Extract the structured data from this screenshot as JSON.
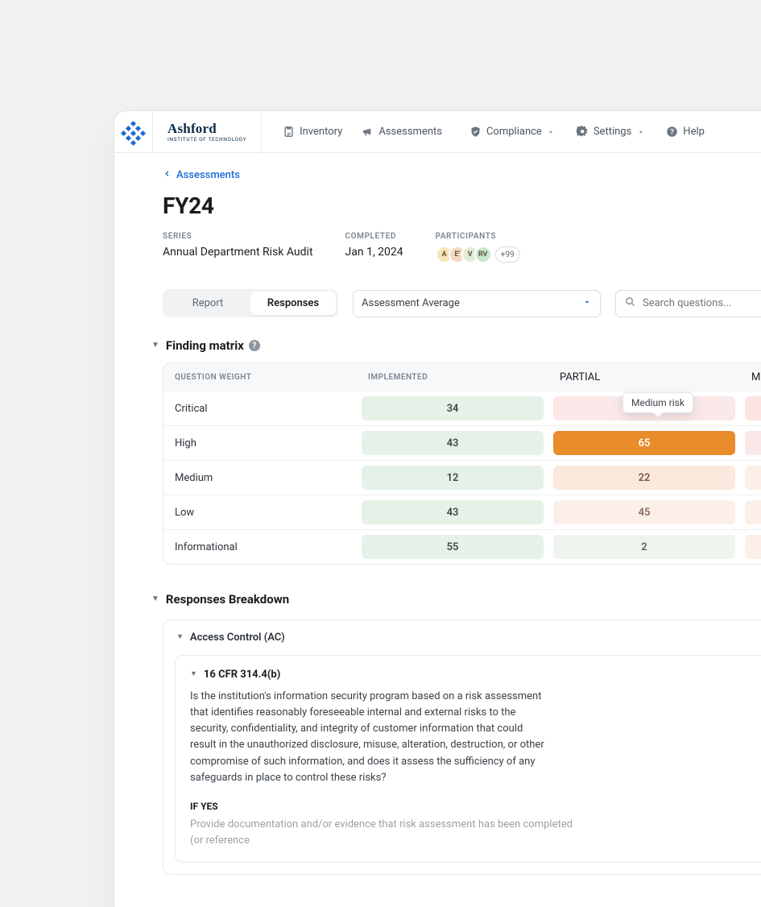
{
  "brand": {
    "name": "Ashford",
    "subtitle": "INSTITUTE OF TECHNOLOGY"
  },
  "nav": {
    "inventory": "Inventory",
    "assessments": "Assessments",
    "compliance": "Compliance",
    "settings": "Settings",
    "help": "Help"
  },
  "breadcrumb": {
    "label": "Assessments"
  },
  "page": {
    "title": "FY24"
  },
  "meta": {
    "series_label": "SERIES",
    "series_value": "Annual Department Risk Audit",
    "completed_label": "COMPLETED",
    "completed_value": "Jan 1, 2024",
    "participants_label": "PARTICIPANTS",
    "avatars": [
      "A",
      "E'",
      "V",
      "RV"
    ],
    "more": "+99"
  },
  "controls": {
    "tab_report": "Report",
    "tab_responses": "Responses",
    "select_value": "Assessment Average",
    "search_placeholder": "Search questions..."
  },
  "finding_matrix": {
    "title": "Finding matrix",
    "help": "?",
    "headers": {
      "weight": "QUESTION WEIGHT",
      "implemented": "IMPLEMENTED",
      "partial": "PARTIAL",
      "missing": "MISSING"
    },
    "tooltip": "Medium risk",
    "rows": [
      {
        "weight": "Critical",
        "implemented": "34",
        "partial": "",
        "partial_class": "c-blank-red",
        "missing_class": "c-blank-crit"
      },
      {
        "weight": "High",
        "implemented": "43",
        "partial": "65",
        "partial_class": "c-orange-strong",
        "missing_class": "c-blank-red"
      },
      {
        "weight": "Medium",
        "implemented": "12",
        "partial": "22",
        "partial_class": "c-peach",
        "missing_class": "c-blank-peach"
      },
      {
        "weight": "Low",
        "implemented": "43",
        "partial": "45",
        "partial_class": "c-peach-light",
        "missing_class": "c-blank-peach"
      },
      {
        "weight": "Informational",
        "implemented": "55",
        "partial": "2",
        "partial_class": "c-green-light",
        "missing_class": "c-blank-peach"
      }
    ]
  },
  "breakdown": {
    "title": "Responses Breakdown",
    "group": "Access Control (AC)",
    "item_code": "16 CFR 314.4(b)",
    "item_body": "Is the institution's information security program based on a risk assessment that identifies reasonably foreseeable internal and external risks to the security, confidentiality, and integrity of customer information that could result in the unauthorized disclosure, misuse, alteration, destruction, or other compromise of such information, and does it assess the sufficiency of any safeguards in place to control these risks?",
    "if_yes_label": "IF YES",
    "if_yes_body": "Provide documentation and/or evidence that risk assessment has been completed (or reference"
  }
}
